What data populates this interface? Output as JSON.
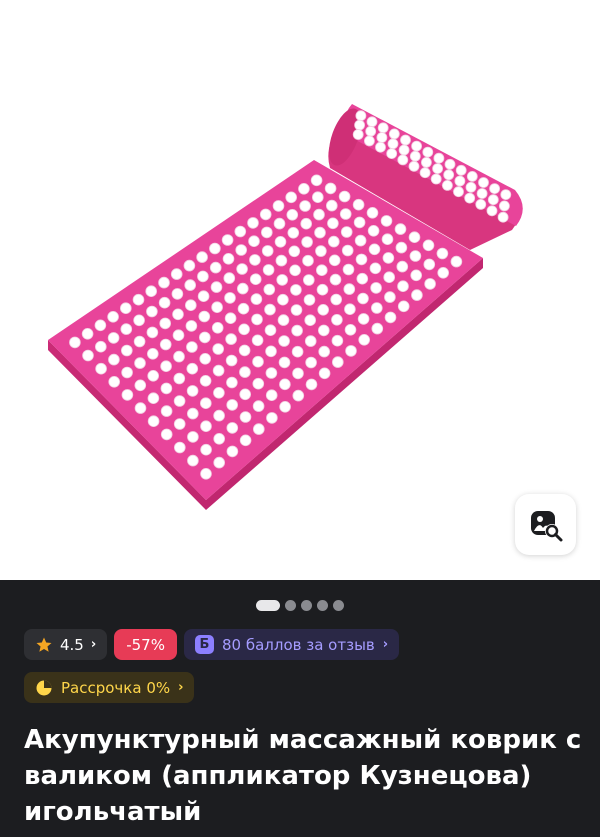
{
  "product": {
    "image_alt": "Акупунктурный массажный коврик с валиком",
    "image_colors": {
      "mat": "#e8418f",
      "spikes": "#ffffff",
      "background": "#ffffff"
    }
  },
  "gallery": {
    "total_slides": 5,
    "active_index": 0
  },
  "badges": {
    "rating": {
      "icon": "star-icon",
      "value": "4.5",
      "chevron": "›"
    },
    "discount": {
      "label": "-57%",
      "color": "#e73b56"
    },
    "points": {
      "badge_letter": "Б",
      "label": "80 баллов за отзыв",
      "chevron": "›"
    },
    "installment": {
      "icon": "pie-chart-icon",
      "label": "Рассрочка 0%",
      "chevron": "›"
    }
  },
  "title": "Акупунктурный массажный коврик с валиком (аппликатор Кузнецова) игольчатый",
  "image_search_button": {
    "icon": "image-search-icon"
  }
}
